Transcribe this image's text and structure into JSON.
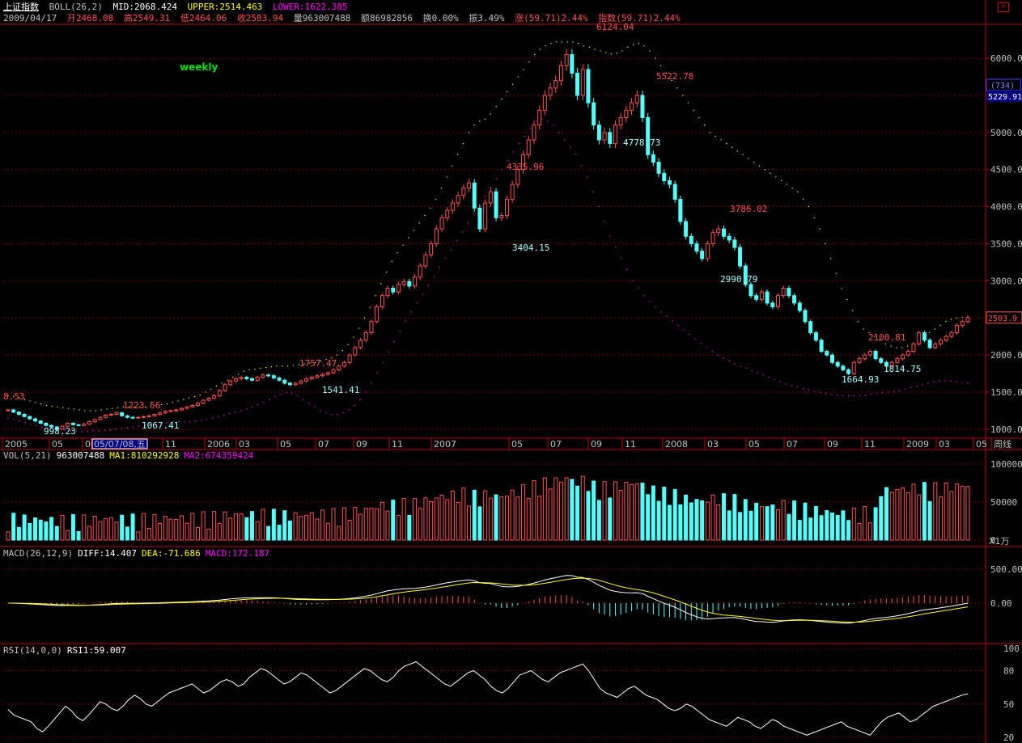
{
  "header": {
    "index_name": "上证指数",
    "indicator": "BOLL(26,2)",
    "mid": "MID:2068.424",
    "upper": "UPPER:2514.463",
    "lower": "LOWER:1622.385",
    "date": "2009/04/17",
    "open": "开2468.08",
    "high": "高2549.31",
    "low": "低2464.06",
    "close": "收2503.94",
    "volume": "量963007488",
    "amount": "额86982856",
    "turnover": "换0.00%",
    "amplitude": "振3.49%",
    "change": "涨(59.71)2.44%",
    "index_change": "指数(59.71)2.44%",
    "period_label": "weekly",
    "vol_header": {
      "name": "VOL(5,21)",
      "value": "963007488",
      "ma1": "MA1:810292928",
      "ma2": "MA2:674359424"
    },
    "macd_header": {
      "name": "MACD(26,12,9)",
      "diff": "DIFF:14.407",
      "dea": "DEA:-71.686",
      "macd": "MACD:172.187"
    },
    "rsi_header": {
      "name": "RSI(14,0,0)",
      "rsi1": "RSI1:59.007"
    }
  },
  "colors": {
    "up": "#ff5050",
    "down": "#54ffff",
    "grid": "#800000",
    "axis": "#c00000",
    "upper": "#ffff00",
    "lower": "#ff00ff",
    "mid": "#ffffff"
  },
  "chart_data": {
    "type": "candlestick",
    "title": "上证指数 weekly",
    "price_axis": {
      "ticks": [
        1000,
        1500,
        2000,
        2500,
        3000,
        3500,
        4000,
        4500,
        5000,
        5500,
        6000
      ],
      "labels": [
        "1000.0",
        "1500.0",
        "2000.0",
        "2500.0",
        "3000.0",
        "3500.0",
        "4000.0",
        "4500.0",
        "5000.0",
        "5500.0",
        "6000.0"
      ],
      "ylim": [
        900,
        6350
      ]
    },
    "time_axis": [
      "2005",
      "05",
      "0",
      "05/07/08,五",
      "11",
      "2006",
      "03",
      "05",
      "07",
      "09",
      "11",
      "2007",
      "05",
      "07",
      "09",
      "11",
      "2008",
      "03",
      "05",
      "07",
      "09",
      "11",
      "2009",
      "03",
      "05",
      "周线"
    ],
    "side_labels": {
      "top": "(734)",
      "value": "5229.91",
      "last": "2503.9"
    },
    "annotations": [
      {
        "text": "8.53",
        "kind": "high"
      },
      {
        "text": "998.23",
        "kind": "low"
      },
      {
        "text": "1223.56",
        "kind": "high"
      },
      {
        "text": "1067.41",
        "kind": "low"
      },
      {
        "text": "1757.47",
        "kind": "high"
      },
      {
        "text": "1541.41",
        "kind": "low"
      },
      {
        "text": "4335.96",
        "kind": "high"
      },
      {
        "text": "3404.15",
        "kind": "low"
      },
      {
        "text": "6124.04",
        "kind": "high"
      },
      {
        "text": "5522.78",
        "kind": "high"
      },
      {
        "text": "4778.73",
        "kind": "low"
      },
      {
        "text": "3786.02",
        "kind": "high"
      },
      {
        "text": "2990.79",
        "kind": "low"
      },
      {
        "text": "2100.81",
        "kind": "high"
      },
      {
        "text": "1664.93",
        "kind": "low"
      },
      {
        "text": "1814.75",
        "kind": "low"
      }
    ],
    "close_series": [
      1260,
      1230,
      1200,
      1170,
      1140,
      1110,
      1080,
      1050,
      1030,
      1000,
      1040,
      1080,
      1060,
      1050,
      1070,
      1100,
      1130,
      1160,
      1190,
      1200,
      1220,
      1180,
      1160,
      1150,
      1160,
      1170,
      1180,
      1200,
      1220,
      1240,
      1250,
      1260,
      1280,
      1300,
      1320,
      1350,
      1390,
      1420,
      1450,
      1520,
      1600,
      1650,
      1680,
      1700,
      1680,
      1660,
      1700,
      1730,
      1720,
      1690,
      1660,
      1620,
      1600,
      1620,
      1650,
      1680,
      1700,
      1720,
      1740,
      1760,
      1800,
      1850,
      1900,
      2000,
      2100,
      2200,
      2300,
      2450,
      2650,
      2800,
      2900,
      2850,
      2950,
      2990,
      2930,
      3050,
      3200,
      3350,
      3500,
      3700,
      3850,
      3950,
      4050,
      4150,
      4250,
      4320,
      3980,
      3700,
      4050,
      4200,
      3850,
      3880,
      4100,
      4300,
      4500,
      4700,
      4900,
      5100,
      5300,
      5500,
      5600,
      5700,
      5900,
      6050,
      5800,
      5500,
      5850,
      5400,
      5100,
      4900,
      5000,
      4850,
      5100,
      5200,
      5300,
      5400,
      5500,
      5200,
      4700,
      4600,
      4450,
      4350,
      4300,
      4100,
      3800,
      3600,
      3500,
      3400,
      3300,
      3500,
      3650,
      3700,
      3600,
      3550,
      3450,
      3200,
      2950,
      2800,
      2750,
      2850,
      2700,
      2650,
      2800,
      2900,
      2800,
      2700,
      2600,
      2450,
      2300,
      2200,
      2050,
      2000,
      1900,
      1850,
      1800,
      1750,
      1900,
      1950,
      2000,
      2050,
      1950,
      1900,
      1850,
      1900,
      1950,
      2000,
      2050,
      2150,
      2300,
      2200,
      2100,
      2150,
      2200,
      2250,
      2300,
      2400,
      2450,
      2503.94
    ],
    "upper_series": [
      1450,
      1440,
      1420,
      1400,
      1380,
      1360,
      1340,
      1320,
      1310,
      1300,
      1290,
      1280,
      1270,
      1260,
      1250,
      1250,
      1250,
      1260,
      1270,
      1280,
      1290,
      1300,
      1300,
      1300,
      1300,
      1300,
      1310,
      1320,
      1330,
      1340,
      1360,
      1380,
      1400,
      1420,
      1440,
      1460,
      1500,
      1540,
      1580,
      1620,
      1660,
      1700,
      1740,
      1780,
      1800,
      1810,
      1820,
      1830,
      1840,
      1850,
      1850,
      1850,
      1860,
      1870,
      1880,
      1890,
      1900,
      1920,
      1940,
      1960,
      2000,
      2060,
      2140,
      2240,
      2360,
      2500,
      2640,
      2800,
      2960,
      3120,
      3260,
      3380,
      3480,
      3580,
      3680,
      3780,
      3880,
      3980,
      4100,
      4250,
      4400,
      4550,
      4700,
      4850,
      5000,
      5100,
      5150,
      5180,
      5250,
      5350,
      5450,
      5550,
      5650,
      5750,
      5850,
      5950,
      6050,
      6120,
      6170,
      6200,
      6220,
      6220,
      6220,
      6220,
      6200,
      6170,
      6150,
      6120,
      6100,
      6080,
      6060,
      6070,
      6100,
      6150,
      6180,
      6200,
      6170,
      6100,
      6000,
      5900,
      5800,
      5700,
      5600,
      5500,
      5400,
      5300,
      5200,
      5100,
      5000,
      4950,
      4900,
      4850,
      4800,
      4750,
      4700,
      4650,
      4600,
      4550,
      4500,
      4450,
      4400,
      4350,
      4300,
      4250,
      4200,
      4100,
      4000,
      3850,
      3700,
      3500,
      3300,
      3100,
      2900,
      2750,
      2600,
      2450,
      2350,
      2300,
      2250,
      2200,
      2150,
      2120,
      2100,
      2100,
      2120,
      2150,
      2200,
      2250,
      2300,
      2350,
      2400,
      2450,
      2480,
      2500,
      2510,
      2514
    ],
    "lower_series": [
      1150,
      1130,
      1110,
      1090,
      1070,
      1050,
      1030,
      1020,
      1010,
      1000,
      990,
      980,
      975,
      970,
      970,
      975,
      980,
      985,
      990,
      1000,
      1010,
      1020,
      1030,
      1040,
      1050,
      1060,
      1070,
      1080,
      1090,
      1100,
      1100,
      1100,
      1100,
      1110,
      1120,
      1130,
      1150,
      1170,
      1190,
      1210,
      1230,
      1250,
      1270,
      1300,
      1330,
      1360,
      1400,
      1440,
      1470,
      1490,
      1480,
      1450,
      1400,
      1350,
      1300,
      1250,
      1220,
      1200,
      1200,
      1220,
      1260,
      1320,
      1400,
      1500,
      1620,
      1760,
      1900,
      2040,
      2180,
      2320,
      2460,
      2580,
      2700,
      2820,
      2940,
      3060,
      3180,
      3300,
      3420,
      3540,
      3660,
      3780,
      3900,
      4020,
      4140,
      4260,
      4380,
      4500,
      4620,
      4740,
      4850,
      4950,
      5050,
      5150,
      5180,
      5150,
      5100,
      5000,
      4900,
      4800,
      4700,
      4550,
      4400,
      4200,
      4000,
      3800,
      3600,
      3450,
      3300,
      3150,
      3000,
      2900,
      2800,
      2720,
      2650,
      2580,
      2520,
      2460,
      2400,
      2340,
      2280,
      2220,
      2160,
      2100,
      2050,
      2000,
      1960,
      1920,
      1880,
      1850,
      1820,
      1790,
      1760,
      1730,
      1700,
      1670,
      1640,
      1610,
      1590,
      1570,
      1550,
      1530,
      1510,
      1495,
      1480,
      1470,
      1460,
      1455,
      1450,
      1450,
      1455,
      1460,
      1470,
      1480,
      1490,
      1500,
      1510,
      1520,
      1540,
      1560,
      1580,
      1600,
      1620,
      1640,
      1650,
      1655,
      1650,
      1640,
      1630,
      1622
    ],
    "volume_axis": {
      "ticks": [
        "100000",
        "50000",
        "0"
      ],
      "unit": "X1万"
    },
    "macd_axis": {
      "ticks": [
        "500.00",
        "0.00"
      ]
    },
    "rsi_axis": {
      "ticks": [
        "100",
        "80",
        "50",
        "20"
      ]
    },
    "rsi_series": [
      45,
      40,
      38,
      36,
      34,
      28,
      25,
      30,
      36,
      42,
      48,
      44,
      38,
      35,
      40,
      46,
      52,
      50,
      46,
      44,
      48,
      54,
      58,
      55,
      50,
      48,
      52,
      56,
      60,
      62,
      64,
      66,
      68,
      64,
      60,
      62,
      66,
      70,
      72,
      70,
      66,
      68,
      74,
      78,
      82,
      80,
      76,
      72,
      68,
      70,
      74,
      78,
      76,
      72,
      68,
      64,
      60,
      62,
      66,
      70,
      74,
      78,
      82,
      80,
      76,
      72,
      70,
      74,
      80,
      84,
      86,
      88,
      84,
      80,
      76,
      72,
      68,
      66,
      70,
      74,
      78,
      80,
      76,
      72,
      66,
      62,
      60,
      64,
      70,
      76,
      78,
      80,
      76,
      72,
      70,
      74,
      78,
      80,
      82,
      84,
      86,
      80,
      72,
      64,
      60,
      58,
      56,
      60,
      64,
      66,
      62,
      58,
      56,
      54,
      50,
      46,
      44,
      46,
      50,
      48,
      44,
      40,
      36,
      34,
      32,
      30,
      34,
      38,
      36,
      34,
      30,
      28,
      32,
      36,
      34,
      30,
      28,
      26,
      24,
      22,
      24,
      26,
      28,
      30,
      32,
      34,
      30,
      28,
      26,
      24,
      22,
      28,
      34,
      38,
      40,
      42,
      38,
      34,
      36,
      40,
      44,
      48,
      50,
      52,
      54,
      56,
      58,
      59
    ]
  }
}
